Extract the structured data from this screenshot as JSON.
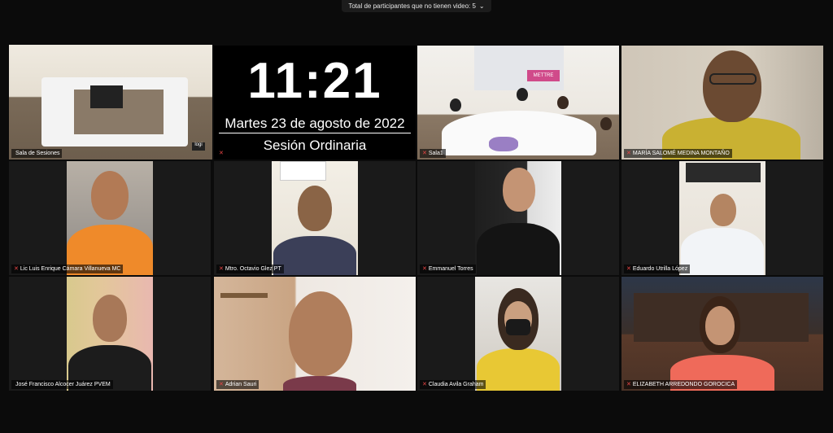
{
  "topbar": {
    "text": "Total de participantes que no tienen video: 5",
    "chevron": "⌄"
  },
  "clock": {
    "time": "11:21",
    "date": "Martes 23 de agosto de 2022",
    "session": "Sesión Ordinaria"
  },
  "tiles": [
    {
      "name": "Sala de Sesiones"
    },
    {
      "name": ""
    },
    {
      "name": "Sala1"
    },
    {
      "name": "MARÍA SALOMÉ MEDINA MONTAÑO"
    },
    {
      "name": "Lic Luis Enrique Cámara Villanueva  MC"
    },
    {
      "name": "Mtro. Octavio Glez PT"
    },
    {
      "name": "Emmanuel Torres"
    },
    {
      "name": "Eduardo Utrilla López"
    },
    {
      "name": "José Francisco Alcocer Juárez PVEM"
    },
    {
      "name": "Adrian Sauri"
    },
    {
      "name": "Claudia Avila Graham"
    },
    {
      "name": "ELIZABETH ARREDONDO GOROCICA"
    }
  ],
  "overlays": {
    "logi": "logi",
    "banner": "METTRE"
  },
  "icons": {
    "muted": "muted-mic-icon"
  },
  "colors": {
    "active_border": "#9bd157",
    "background": "#0b0b0b",
    "mic": "#e84545"
  }
}
